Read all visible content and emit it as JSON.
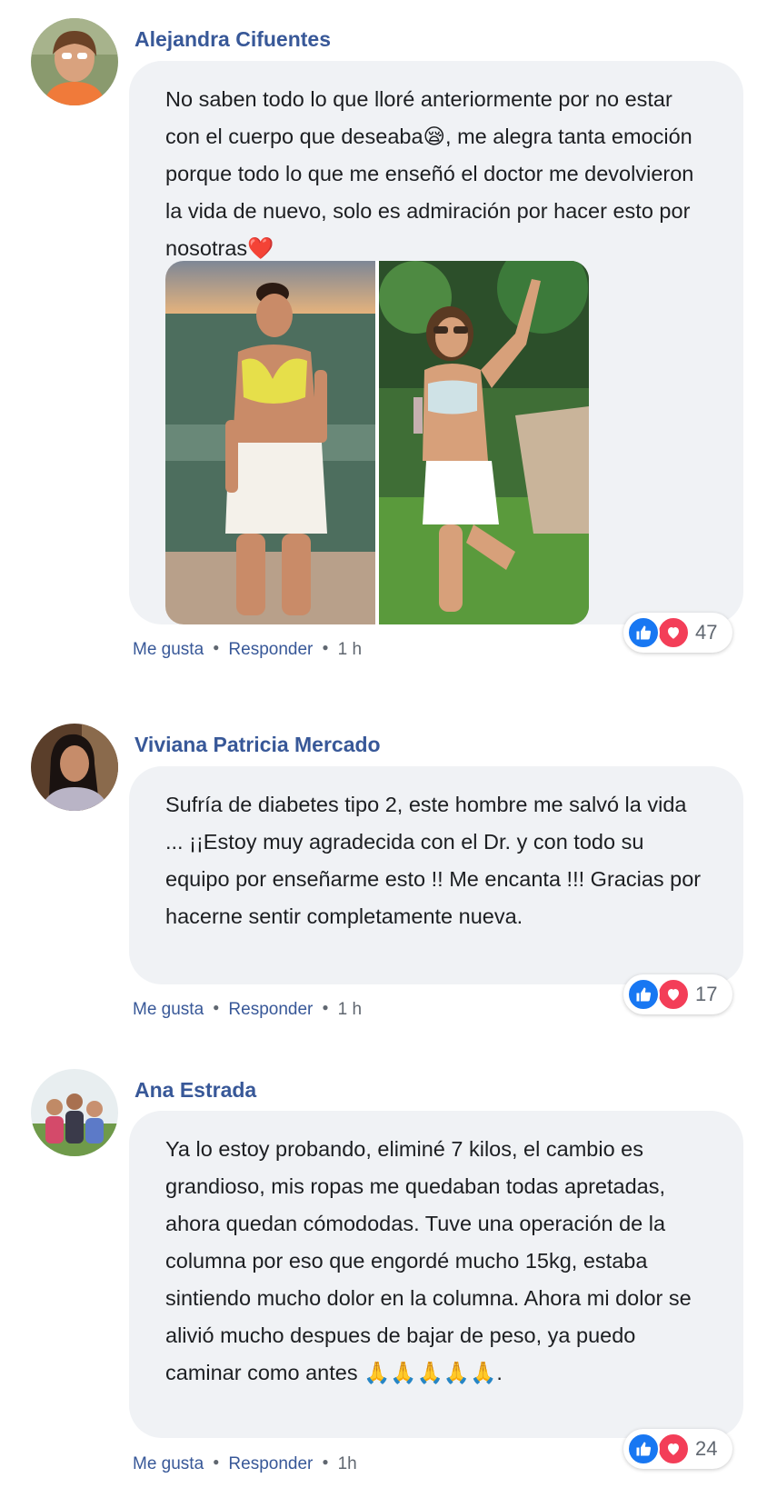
{
  "icons": {
    "like": "thumbs-up-icon",
    "love": "heart-icon",
    "emoji_sad": "sad-face-emoji",
    "emoji_heart": "red-heart-emoji",
    "emoji_pray": "folded-hands-emoji"
  },
  "colors": {
    "author": "#385898",
    "bubble": "#f0f2f5",
    "like": "#1877f2",
    "love": "#f33e58"
  },
  "comments": [
    {
      "author": "Alejandra Cifuentes",
      "text": "No saben todo lo que lloré anteriormente por no estar con el cuerpo que deseaba😪, me alegra tanta emoción porque todo lo que me enseñó el doctor me devolvieron la vida de nuevo, solo es admiración por hacer esto por nosotras❤️",
      "has_photos": true,
      "actions": {
        "like": "Me gusta",
        "reply": "Responder",
        "time": "1 h"
      },
      "reaction_count": "47"
    },
    {
      "author": "Viviana Patricia Mercado",
      "text": "Sufría de diabetes tipo 2, este hombre me salvó la vida ... ¡¡Estoy muy agradecida con el Dr. y con todo su equipo por enseñarme esto !! Me encanta !!! Gracias por hacerne sentir completamente nueva.",
      "has_photos": false,
      "actions": {
        "like": "Me gusta",
        "reply": "Responder",
        "time": "1 h"
      },
      "reaction_count": "17"
    },
    {
      "author": "Ana Estrada",
      "text": "Ya lo estoy probando, eliminé 7 kilos, el cambio es grandioso, mis ropas me quedaban todas apretadas, ahora quedan cómododas. Tuve una operación de la columna por eso que engordé mucho 15kg, estaba sintiendo mucho dolor en la columna. Ahora mi dolor se alivió mucho despues de bajar de peso, ya puedo caminar como antes 🙏🙏🙏🙏🙏.",
      "has_photos": false,
      "actions": {
        "like": "Me gusta",
        "reply": "Responder",
        "time": "1h"
      },
      "reaction_count": "24"
    }
  ]
}
